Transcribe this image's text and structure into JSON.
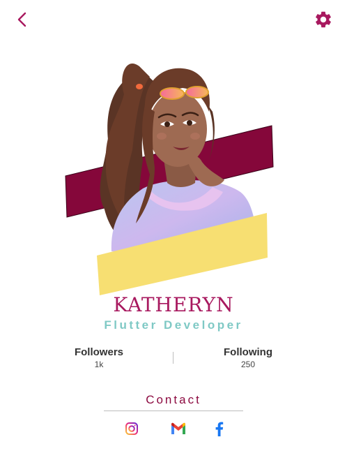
{
  "profile": {
    "name": "KATHERYN",
    "role": "Flutter Developer"
  },
  "stats": {
    "followers_label": "Followers",
    "followers_value": "1k",
    "following_label": "Following",
    "following_value": "250"
  },
  "contact": {
    "title": "Contact"
  },
  "colors": {
    "accent": "#a8195f",
    "banner_maroon": "#85073a",
    "banner_yellow": "#f7df72",
    "role_teal": "#7fc9c5"
  },
  "icons": {
    "back": "chevron-left-icon",
    "settings": "gear-icon",
    "instagram": "instagram-icon",
    "gmail": "gmail-icon",
    "facebook": "facebook-icon"
  }
}
